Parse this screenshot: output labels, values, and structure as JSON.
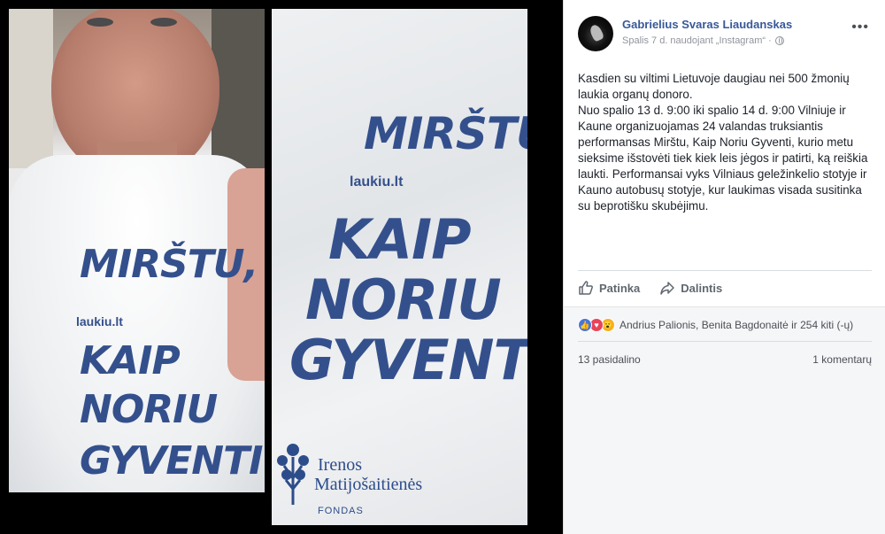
{
  "post": {
    "author": "Gabrielius Svaras Liaudanskas",
    "meta": "Spalis 7 d. naudojant „Instagram“ ·",
    "more_icon": "more-options-icon",
    "text_lines": [
      "Kasdien su viltimi Lietuvoje daugiau nei 500 žmonių laukia organų donoro.",
      "Nuo spalio 13 d. 9:00 iki spalio 14 d. 9:00 Vilniuje ir Kaune organizuojamas 24 valandas truksiantis performansas Mirštu, Kaip Noriu Gyventi, kurio metu sieksime išstovėti tiek kiek leis jėgos ir patirti, ką reiškia laukti. Performansai vyks Vilniaus geležinkelio stotyje ir Kauno autobusų stotyje, kur laukimas visada susitinka su beprotišku skubėjimu."
    ],
    "actions": {
      "like": "Patinka",
      "share": "Dalintis"
    },
    "reactions": {
      "icons": [
        "like-reaction-icon",
        "love-reaction-icon",
        "wow-reaction-icon"
      ],
      "text": "Andrius Palionis, Benita Bagdonaitė ir 254 kiti (-ų)"
    },
    "shares": "13 pasidalino",
    "comments": "1 komentarų"
  },
  "photos": {
    "left_print": {
      "line1": "MIRŠTU,",
      "site": "laukiu.lt",
      "line2": "KAIP",
      "line3": "NORIU",
      "line4": "GYVENTI"
    },
    "right_print": {
      "line1": "MIRŠTU,",
      "site": "laukiu.lt",
      "line2": "KAIP",
      "line3": "NORIU",
      "line4": "GYVENTI",
      "logo_line1": "Irenos",
      "logo_line2": "Matijošaitienės",
      "logo_sub": "FONDAS"
    }
  },
  "colors": {
    "link": "#385898",
    "print": "#34508c",
    "like": "#4a76d8",
    "love": "#e9445a",
    "wow": "#f7b125"
  }
}
